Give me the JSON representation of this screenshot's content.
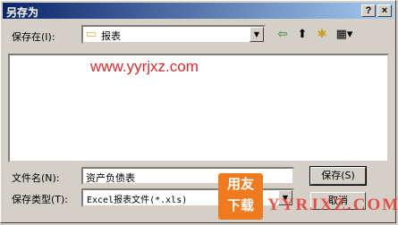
{
  "window": {
    "title": "另存为",
    "help_btn": "?",
    "close_btn": "×"
  },
  "save_in": {
    "label": "保存在(I):",
    "value": "报表"
  },
  "watermark": "www.yyrjxz.com",
  "filename": {
    "label": "文件名(N):",
    "value": "资产负债表"
  },
  "filetype": {
    "label": "保存类型(T):",
    "value": "Excel报表文件(*.xls)"
  },
  "buttons": {
    "save": "保存(S)",
    "cancel": "取消"
  },
  "logo": {
    "line1": "用友",
    "line2": "下载",
    "brand": "YYRJXZ.COM"
  }
}
